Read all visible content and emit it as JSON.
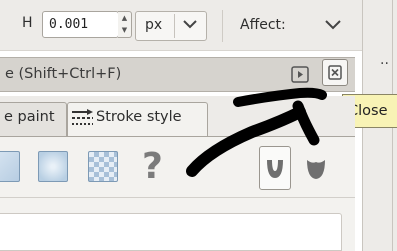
{
  "toolbar": {
    "h_label": "H",
    "h_value": "0.001",
    "spin_up": "▲",
    "spin_down": "▼",
    "unit": "px",
    "affect_label": "Affect:"
  },
  "dialog": {
    "title": "e (Shift+Ctrl+F)",
    "close_tooltip": "Close"
  },
  "tabs": [
    {
      "label": "e paint"
    },
    {
      "label": "Stroke style"
    }
  ],
  "paint_buttons": {
    "unknown_glyph": "?"
  },
  "right_panel": {
    "dots": "··"
  },
  "colors": {
    "annotation": "#000000",
    "tooltip_bg": "#f8f3b5",
    "header_bg": "#d6d3ce"
  }
}
